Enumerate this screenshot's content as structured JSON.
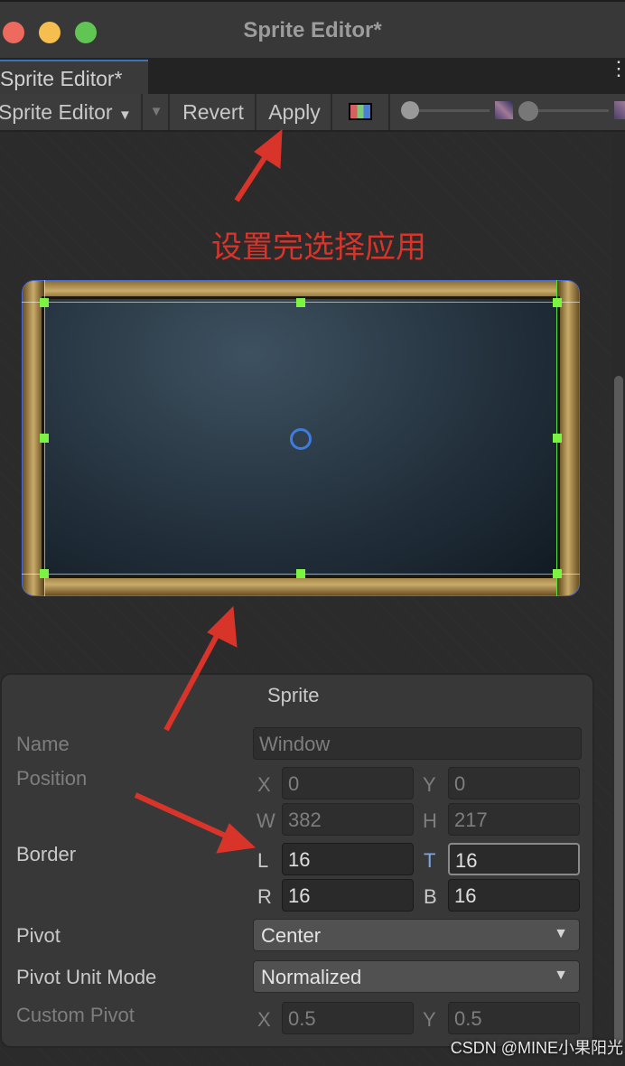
{
  "window": {
    "title": "Sprite Editor*"
  },
  "tab": {
    "label": "Sprite Editor*"
  },
  "toolbar": {
    "mode_label": "Sprite Editor",
    "revert_label": "Revert",
    "apply_label": "Apply"
  },
  "annotation": {
    "text": "设置完选择应用",
    "color": "#d9342a"
  },
  "panel": {
    "title": "Sprite",
    "name": {
      "label": "Name",
      "value": "Window"
    },
    "position": {
      "label": "Position",
      "x_label": "X",
      "x": "0",
      "y_label": "Y",
      "y": "0",
      "w_label": "W",
      "w": "382",
      "h_label": "H",
      "h": "217"
    },
    "border": {
      "label": "Border",
      "l_label": "L",
      "l": "16",
      "t_label": "T",
      "t": "16",
      "r_label": "R",
      "r": "16",
      "b_label": "B",
      "b": "16"
    },
    "pivot": {
      "label": "Pivot",
      "value": "Center"
    },
    "pivot_unit_mode": {
      "label": "Pivot Unit Mode",
      "value": "Normalized"
    },
    "custom_pivot": {
      "label": "Custom Pivot",
      "x_label": "X",
      "x": "0.5",
      "y_label": "Y",
      "y": "0.5"
    }
  },
  "watermark": "CSDN @MINE小果阳光"
}
